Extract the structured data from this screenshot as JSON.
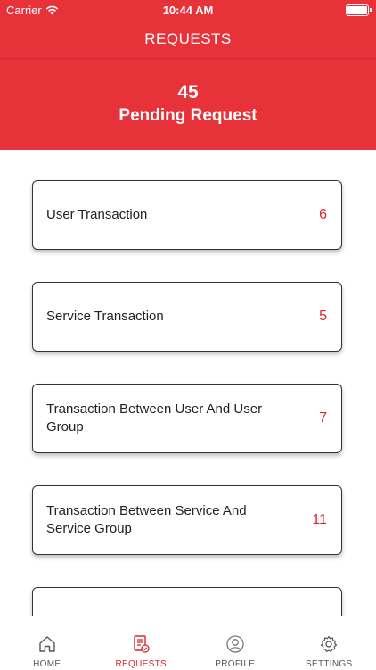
{
  "status_bar": {
    "carrier": "Carrier",
    "time": "10:44 AM"
  },
  "header": {
    "title": "REQUESTS",
    "pending_count": "45",
    "pending_label": "Pending Request"
  },
  "requests": [
    {
      "label": "User Transaction",
      "count": "6"
    },
    {
      "label": "Service Transaction",
      "count": "5"
    },
    {
      "label": "Transaction Between User And User Group",
      "count": "7"
    },
    {
      "label": "Transaction Between Service And Service Group",
      "count": "11"
    },
    {
      "label": "",
      "count": ""
    }
  ],
  "tabs": [
    {
      "label": "HOME",
      "icon": "home-icon",
      "active": false
    },
    {
      "label": "REQUESTS",
      "icon": "requests-icon",
      "active": true
    },
    {
      "label": "PROFILE",
      "icon": "profile-icon",
      "active": false
    },
    {
      "label": "SETTINGS",
      "icon": "gear-icon",
      "active": false
    }
  ],
  "colors": {
    "brand_red": "#e8323a",
    "accent_red": "#d9262f"
  }
}
